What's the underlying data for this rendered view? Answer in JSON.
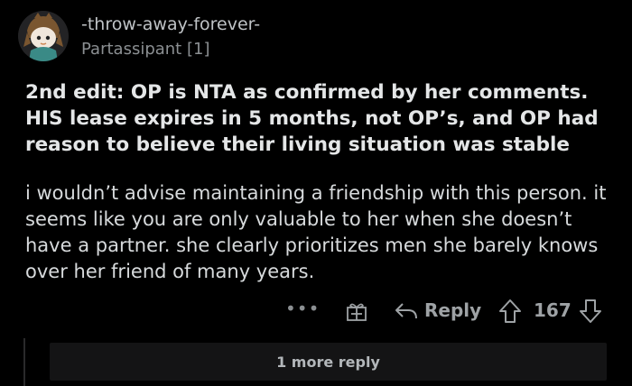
{
  "comment": {
    "username": "-throw-away-forever-",
    "flair": "Partassipant [1]",
    "edit_text": "2nd edit: OP is NTA as confirmed by her comments. HIS lease expires in 5 months, not OP’s, and OP had reason to believe their living situation was stable",
    "body_text": "i wouldn’t advise maintaining a friendship with this person. it seems like you are only valuable to her when she doesn’t have a partner. she clearly prioritizes men she barely knows over her friend of many years."
  },
  "actions": {
    "more_label": "•••",
    "reply_label": "Reply",
    "score": "167"
  },
  "more_replies_label": "1 more reply",
  "icons": {
    "avatar": "avatar",
    "award": "gift-icon",
    "reply": "reply-arrow-icon",
    "upvote": "upvote-icon",
    "downvote": "downvote-icon"
  },
  "colors": {
    "background": "#000000",
    "text": "#d7dadc",
    "muted": "#8b8f92"
  }
}
